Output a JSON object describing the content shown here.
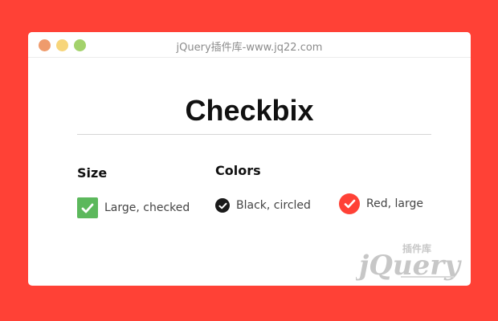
{
  "window": {
    "title": "jQuery插件库-www.jq22.com"
  },
  "page": {
    "title": "Checkbix"
  },
  "sections": {
    "size": {
      "heading": "Size",
      "options": [
        {
          "label": "Large, checked",
          "checked": true,
          "color": "#5cb85c",
          "shape": "square"
        }
      ]
    },
    "colors": {
      "heading": "Colors",
      "options": [
        {
          "label": "Black, circled",
          "checked": true,
          "color": "#1a1a1a",
          "shape": "circle"
        },
        {
          "label": "Red, large",
          "checked": true,
          "color": "#ff4136",
          "shape": "circle"
        }
      ]
    }
  },
  "watermark": {
    "logo_text": "jQuery",
    "logo_subtext": "插件库"
  },
  "colors": {
    "background": "#ff4136",
    "window": "#ffffff",
    "traffic_red": "#ef9b6c",
    "traffic_yellow": "#f7d57a",
    "traffic_green": "#a3d26b"
  }
}
